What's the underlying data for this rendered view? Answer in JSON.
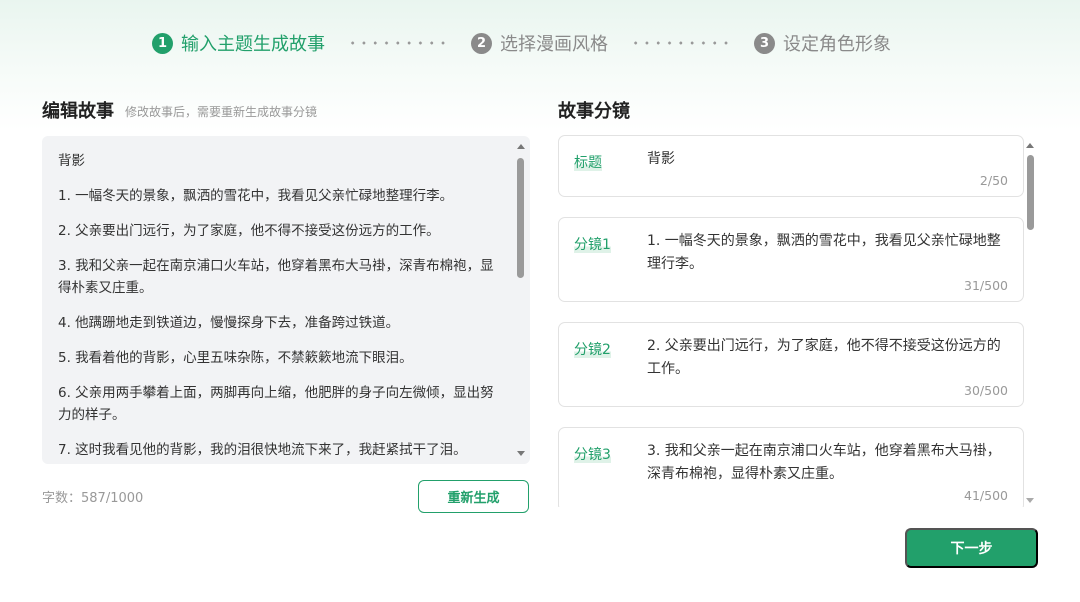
{
  "stepper": {
    "steps": [
      {
        "num": "1",
        "label": "输入主题生成故事",
        "state": "active"
      },
      {
        "num": "2",
        "label": "选择漫画风格",
        "state": "inactive"
      },
      {
        "num": "3",
        "label": "设定角色形象",
        "state": "inactive"
      }
    ]
  },
  "editor": {
    "title": "编辑故事",
    "subtitle": "修改故事后，需要重新生成故事分镜",
    "paragraphs": [
      "背影",
      "1. 一幅冬天的景象，飘洒的雪花中，我看见父亲忙碌地整理行李。",
      "2. 父亲要出门远行，为了家庭，他不得不接受这份远方的工作。",
      "3. 我和父亲一起在南京浦口火车站，他穿着黑布大马褂，深青布棉袍，显得朴素又庄重。",
      "4. 他蹒跚地走到铁道边，慢慢探身下去，准备跨过铁道。",
      "5. 我看着他的背影，心里五味杂陈，不禁簌簌地流下眼泪。",
      "6. 父亲用两手攀着上面，两脚再向上缩，他肥胖的身子向左微倾，显出努力的样子。",
      "7. 这时我看见他的背影，我的泪很快地流下来了，我赶紧拭干了泪。"
    ],
    "char_count": "字数：587/1000",
    "regen_label": "重新生成"
  },
  "storyboard": {
    "title": "故事分镜",
    "cards": [
      {
        "label": "标题",
        "text": "背影",
        "count": "2/50"
      },
      {
        "label": "分镜1",
        "text": "1. 一幅冬天的景象，飘洒的雪花中，我看见父亲忙碌地整理行李。",
        "count": "31/500"
      },
      {
        "label": "分镜2",
        "text": "2. 父亲要出门远行，为了家庭，他不得不接受这份远方的工作。",
        "count": "30/500"
      },
      {
        "label": "分镜3",
        "text": "3. 我和父亲一起在南京浦口火车站，他穿着黑布大马褂，深青布棉袍，显得朴素又庄重。",
        "count": "41/500"
      }
    ]
  },
  "next_label": "下一步",
  "colors": {
    "accent": "#22a06b",
    "inactive": "#8a8a8a",
    "editor_bg": "#f2f3f5"
  }
}
